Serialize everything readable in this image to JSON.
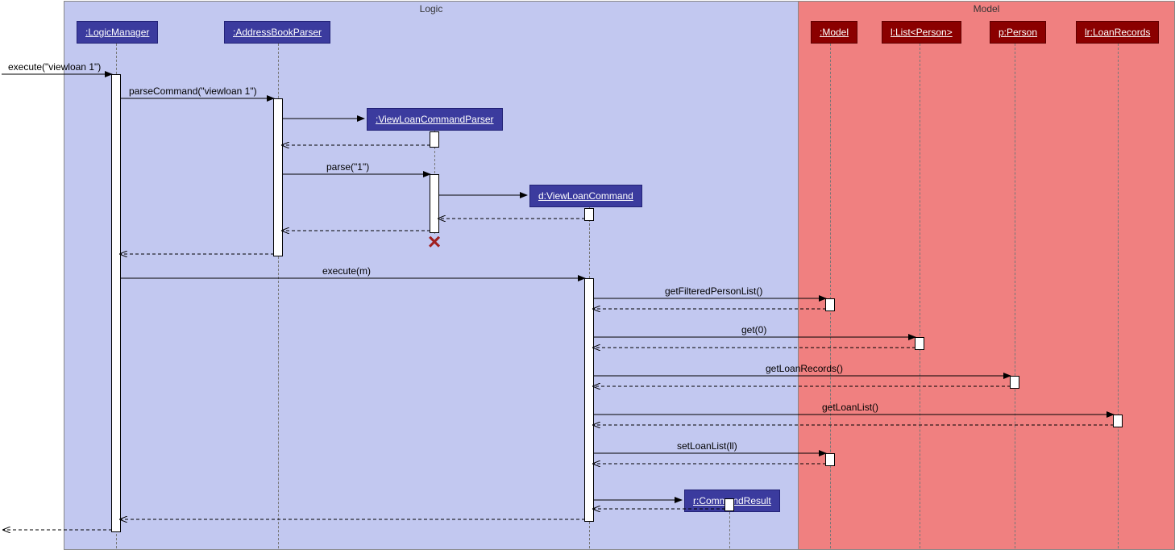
{
  "chart_data": {
    "type": "sequence-diagram",
    "regions": [
      {
        "name": "Logic",
        "participants": [
          ":LogicManager",
          ":AddressBookParser",
          ":ViewLoanCommandParser",
          "d:ViewLoanCommand",
          "r:CommandResult"
        ]
      },
      {
        "name": "Model",
        "participants": [
          ":Model",
          "l:List<Person>",
          "p:Person",
          "lr:LoanRecords"
        ]
      }
    ],
    "messages": [
      {
        "from": "external",
        "to": ":LogicManager",
        "label": "execute(\"viewloan 1\")"
      },
      {
        "from": ":LogicManager",
        "to": ":AddressBookParser",
        "label": "parseCommand(\"viewloan 1\")"
      },
      {
        "from": ":AddressBookParser",
        "to": ":ViewLoanCommandParser",
        "label": "",
        "type": "create"
      },
      {
        "from": ":ViewLoanCommandParser",
        "to": ":AddressBookParser",
        "label": "",
        "type": "return"
      },
      {
        "from": ":AddressBookParser",
        "to": ":ViewLoanCommandParser",
        "label": "parse(\"1\")"
      },
      {
        "from": ":ViewLoanCommandParser",
        "to": "d:ViewLoanCommand",
        "label": "",
        "type": "create"
      },
      {
        "from": "d:ViewLoanCommand",
        "to": ":ViewLoanCommandParser",
        "label": "",
        "type": "return"
      },
      {
        "from": ":ViewLoanCommandParser",
        "to": ":AddressBookParser",
        "label": "",
        "type": "return"
      },
      {
        "from": ":ViewLoanCommandParser",
        "type": "destroy"
      },
      {
        "from": ":AddressBookParser",
        "to": ":LogicManager",
        "label": "",
        "type": "return"
      },
      {
        "from": ":LogicManager",
        "to": "d:ViewLoanCommand",
        "label": "execute(m)"
      },
      {
        "from": "d:ViewLoanCommand",
        "to": ":Model",
        "label": "getFilteredPersonList()"
      },
      {
        "from": ":Model",
        "to": "d:ViewLoanCommand",
        "label": "",
        "type": "return"
      },
      {
        "from": "d:ViewLoanCommand",
        "to": "l:List<Person>",
        "label": "get(0)"
      },
      {
        "from": "l:List<Person>",
        "to": "d:ViewLoanCommand",
        "label": "",
        "type": "return"
      },
      {
        "from": "d:ViewLoanCommand",
        "to": "p:Person",
        "label": "getLoanRecords()"
      },
      {
        "from": "p:Person",
        "to": "d:ViewLoanCommand",
        "label": "",
        "type": "return"
      },
      {
        "from": "d:ViewLoanCommand",
        "to": "lr:LoanRecords",
        "label": "getLoanList()"
      },
      {
        "from": "lr:LoanRecords",
        "to": "d:ViewLoanCommand",
        "label": "",
        "type": "return"
      },
      {
        "from": "d:ViewLoanCommand",
        "to": ":Model",
        "label": "setLoanList(ll)"
      },
      {
        "from": ":Model",
        "to": "d:ViewLoanCommand",
        "label": "",
        "type": "return"
      },
      {
        "from": "d:ViewLoanCommand",
        "to": "r:CommandResult",
        "label": "",
        "type": "create"
      },
      {
        "from": "r:CommandResult",
        "to": "d:ViewLoanCommand",
        "label": "",
        "type": "return"
      },
      {
        "from": "d:ViewLoanCommand",
        "to": ":LogicManager",
        "label": "",
        "type": "return"
      },
      {
        "from": ":LogicManager",
        "to": "external",
        "label": "",
        "type": "return"
      }
    ]
  },
  "regions": {
    "logic": "Logic",
    "model": "Model"
  },
  "actors": {
    "logicManager": ":LogicManager",
    "addressBookParser": ":AddressBookParser",
    "viewLoanCommandParser": ":ViewLoanCommandParser",
    "viewLoanCommand": "d:ViewLoanCommand",
    "commandResult": "r:CommandResult",
    "model": ":Model",
    "listPerson": "l:List<Person>",
    "person": "p:Person",
    "loanRecords": "lr:LoanRecords"
  },
  "messages": {
    "m1": "execute(\"viewloan 1\")",
    "m2": "parseCommand(\"viewloan 1\")",
    "m3": "parse(\"1\")",
    "m4": "execute(m)",
    "m5": "getFilteredPersonList()",
    "m6": "get(0)",
    "m7": "getLoanRecords()",
    "m8": "getLoanList()",
    "m9": "setLoanList(ll)"
  }
}
